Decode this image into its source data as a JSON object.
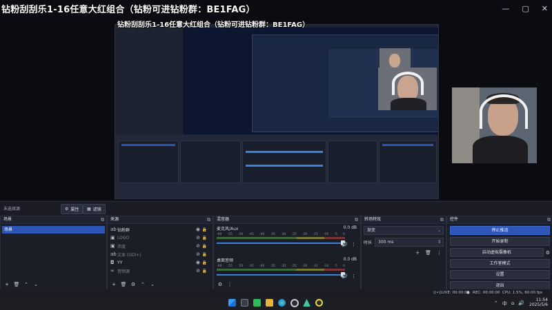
{
  "overlay": {
    "title": "钻粉刮刮乐1-16任意大红组合（钻粉可进钻粉群：BE1FAG）",
    "nested_title": "钻粉刮刮乐1-16任意大红组合（钻粉可进钻粉群：BE1FAG）"
  },
  "window_controls": {
    "minimize": "—",
    "maximize": "▢",
    "close": "✕"
  },
  "source_toolbar": {
    "no_source": "未选择源",
    "properties": "属性",
    "filters": "滤镜"
  },
  "scenes": {
    "title": "场景",
    "items": [
      "场景"
    ]
  },
  "sources": {
    "title": "来源",
    "items": [
      {
        "name": "钻粉群",
        "icon": "text-icon",
        "visible": true,
        "locked": true
      },
      {
        "name": "LOGO",
        "icon": "image-icon",
        "visible": false,
        "locked": true
      },
      {
        "name": "浓度",
        "icon": "image-icon",
        "visible": false,
        "locked": true
      },
      {
        "name": "文本 (GDI+)",
        "icon": "text-icon",
        "visible": false,
        "locked": true
      },
      {
        "name": "YY",
        "icon": "camera-icon",
        "visible": true,
        "locked": true
      },
      {
        "name": "音频源",
        "icon": "link-icon",
        "visible": false,
        "locked": true
      }
    ]
  },
  "mixer": {
    "title": "混音器",
    "channels": [
      {
        "name": "麦克风/Aux",
        "db": "0.0 dB",
        "level": 1.0
      },
      {
        "name": "桌面音频",
        "db": "0.0 dB",
        "level": 1.0
      }
    ],
    "ticks": [
      "-60",
      "-55",
      "-50",
      "-45",
      "-40",
      "-35",
      "-30",
      "-25",
      "-20",
      "-15",
      "-10",
      "-5",
      "0"
    ]
  },
  "transitions": {
    "title": "转场特效",
    "selected": "渐变",
    "duration_label": "时长",
    "duration_value": "300 ms"
  },
  "controls": {
    "title": "控件",
    "buttons": [
      "停止推流",
      "开始录制",
      "启动虚拟摄像机",
      "工作室模式",
      "设置",
      "退出"
    ]
  },
  "status": {
    "live": "LIVE: 00:00:00",
    "rec": "REC: 00:00:00",
    "cpu": "CPU: 1.5%, 60.00 fps"
  },
  "taskbar": {
    "time": "11:54",
    "date": "2025/5/6",
    "ime": "中",
    "icons": [
      "windows-icon",
      "task-view-icon",
      "app-green-icon",
      "folder-icon",
      "edge-icon",
      "obs-icon",
      "app-teal-icon",
      "app-yellow-icon"
    ]
  },
  "colors": {
    "accent": "#2e55b8",
    "background": "#14151c",
    "panel": "#1c1e27"
  }
}
